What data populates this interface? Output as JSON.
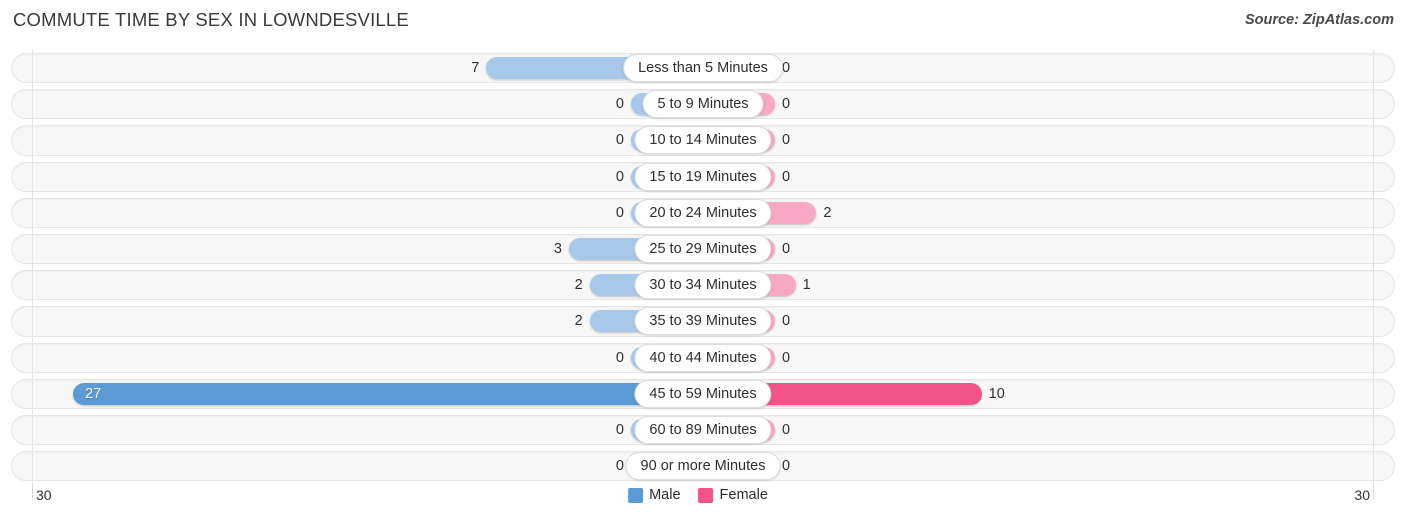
{
  "header": {
    "title": "COMMUTE TIME BY SEX IN LOWNDESVILLE",
    "source": "Source: ZipAtlas.com"
  },
  "legend": {
    "male_label": "Male",
    "female_label": "Female",
    "male_color": "#5B9BD5",
    "female_color": "#F2548A"
  },
  "palette": {
    "male_normal": "#A8C8EA",
    "male_highlight": "#5B9BD5",
    "female_normal": "#F8A8C4",
    "female_highlight": "#F2548A",
    "track_bg": "#F7F7F7",
    "track_border": "#E6E6E6"
  },
  "axis": {
    "left_label": "30",
    "right_label": "30",
    "max": 30
  },
  "chart_data": {
    "type": "bar",
    "subtype": "diverging-population-pyramid",
    "title": "COMMUTE TIME BY SEX IN LOWNDESVILLE",
    "xlabel": "",
    "ylabel": "",
    "xlim": [
      30,
      30
    ],
    "grid": false,
    "legend_position": "bottom-center",
    "categories": [
      "Less than 5 Minutes",
      "5 to 9 Minutes",
      "10 to 14 Minutes",
      "15 to 19 Minutes",
      "20 to 24 Minutes",
      "25 to 29 Minutes",
      "30 to 34 Minutes",
      "35 to 39 Minutes",
      "40 to 44 Minutes",
      "45 to 59 Minutes",
      "60 to 89 Minutes",
      "90 or more Minutes"
    ],
    "series": [
      {
        "name": "Male",
        "values": [
          7,
          0,
          0,
          0,
          0,
          3,
          2,
          2,
          0,
          27,
          0,
          0
        ]
      },
      {
        "name": "Female",
        "values": [
          0,
          0,
          0,
          0,
          2,
          0,
          1,
          0,
          0,
          10,
          0,
          0
        ]
      }
    ]
  },
  "rows": [
    {
      "label": "Less than 5 Minutes",
      "male": "7",
      "female": "0",
      "male_hl": false,
      "female_hl": false
    },
    {
      "label": "5 to 9 Minutes",
      "male": "0",
      "female": "0",
      "male_hl": false,
      "female_hl": false
    },
    {
      "label": "10 to 14 Minutes",
      "male": "0",
      "female": "0",
      "male_hl": false,
      "female_hl": false
    },
    {
      "label": "15 to 19 Minutes",
      "male": "0",
      "female": "0",
      "male_hl": false,
      "female_hl": false
    },
    {
      "label": "20 to 24 Minutes",
      "male": "0",
      "female": "2",
      "male_hl": false,
      "female_hl": false
    },
    {
      "label": "25 to 29 Minutes",
      "male": "3",
      "female": "0",
      "male_hl": false,
      "female_hl": false
    },
    {
      "label": "30 to 34 Minutes",
      "male": "2",
      "female": "1",
      "male_hl": false,
      "female_hl": false
    },
    {
      "label": "35 to 39 Minutes",
      "male": "2",
      "female": "0",
      "male_hl": false,
      "female_hl": false
    },
    {
      "label": "40 to 44 Minutes",
      "male": "0",
      "female": "0",
      "male_hl": false,
      "female_hl": false
    },
    {
      "label": "45 to 59 Minutes",
      "male": "27",
      "female": "10",
      "male_hl": true,
      "female_hl": true
    },
    {
      "label": "60 to 89 Minutes",
      "male": "0",
      "female": "0",
      "male_hl": false,
      "female_hl": false
    },
    {
      "label": "90 or more Minutes",
      "male": "0",
      "female": "0",
      "male_hl": false,
      "female_hl": false
    }
  ]
}
